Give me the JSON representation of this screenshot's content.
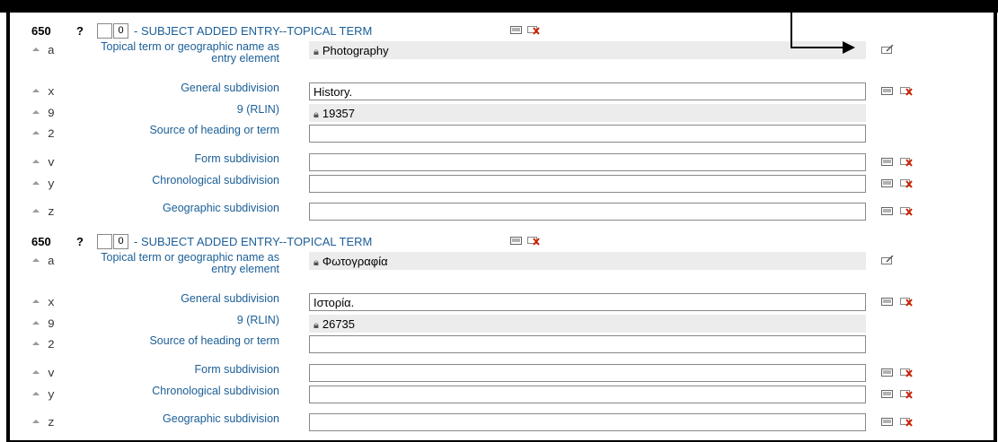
{
  "fields": [
    {
      "tag": "650",
      "help": "?",
      "ind1": "",
      "ind2": "0",
      "title": "- SUBJECT ADDED ENTRY--TOPICAL TERM",
      "subfields": [
        {
          "code": "a",
          "label": "Topical term or geographic name as entry element",
          "value": "Photography",
          "readonly": true,
          "locked": true,
          "icons": [
            "edit-icon"
          ]
        },
        {
          "code": "x",
          "label": "General subdivision",
          "value": "History.",
          "readonly": false,
          "locked": false,
          "icons": [
            "clone-icon",
            "delete-icon"
          ]
        },
        {
          "code": "9",
          "label": "9 (RLIN)",
          "value": "19357",
          "readonly": true,
          "locked": true,
          "icons": []
        },
        {
          "code": "2",
          "label": "Source of heading or term",
          "value": "",
          "readonly": false,
          "locked": false,
          "icons": []
        },
        {
          "code": "v",
          "label": "Form subdivision",
          "value": "",
          "readonly": false,
          "locked": false,
          "icons": [
            "clone-icon",
            "delete-icon"
          ]
        },
        {
          "code": "y",
          "label": "Chronological subdivision",
          "value": "",
          "readonly": false,
          "locked": false,
          "icons": [
            "clone-icon",
            "delete-icon"
          ]
        },
        {
          "code": "z",
          "label": "Geographic subdivision",
          "value": "",
          "readonly": false,
          "locked": false,
          "icons": [
            "clone-icon",
            "delete-icon"
          ]
        }
      ]
    },
    {
      "tag": "650",
      "help": "?",
      "ind1": "",
      "ind2": "0",
      "title": "- SUBJECT ADDED ENTRY--TOPICAL TERM",
      "subfields": [
        {
          "code": "a",
          "label": "Topical term or geographic name as entry element",
          "value": "Φωτογραφία",
          "readonly": true,
          "locked": true,
          "icons": [
            "edit-icon"
          ]
        },
        {
          "code": "x",
          "label": "General subdivision",
          "value": "Ιστορία.",
          "readonly": false,
          "locked": false,
          "icons": [
            "clone-icon",
            "delete-icon"
          ]
        },
        {
          "code": "9",
          "label": "9 (RLIN)",
          "value": "26735",
          "readonly": true,
          "locked": true,
          "icons": []
        },
        {
          "code": "2",
          "label": "Source of heading or term",
          "value": "",
          "readonly": false,
          "locked": false,
          "icons": []
        },
        {
          "code": "v",
          "label": "Form subdivision",
          "value": "",
          "readonly": false,
          "locked": false,
          "icons": [
            "clone-icon",
            "delete-icon"
          ]
        },
        {
          "code": "y",
          "label": "Chronological subdivision",
          "value": "",
          "readonly": false,
          "locked": false,
          "icons": [
            "clone-icon",
            "delete-icon"
          ]
        },
        {
          "code": "z",
          "label": "Geographic subdivision",
          "value": "",
          "readonly": false,
          "locked": false,
          "icons": [
            "clone-icon",
            "delete-icon"
          ]
        }
      ]
    }
  ],
  "colors": {
    "label": "#1b5e96",
    "readonly_bg": "#ececec",
    "frame": "#000000",
    "delete_red": "#cc2200"
  }
}
